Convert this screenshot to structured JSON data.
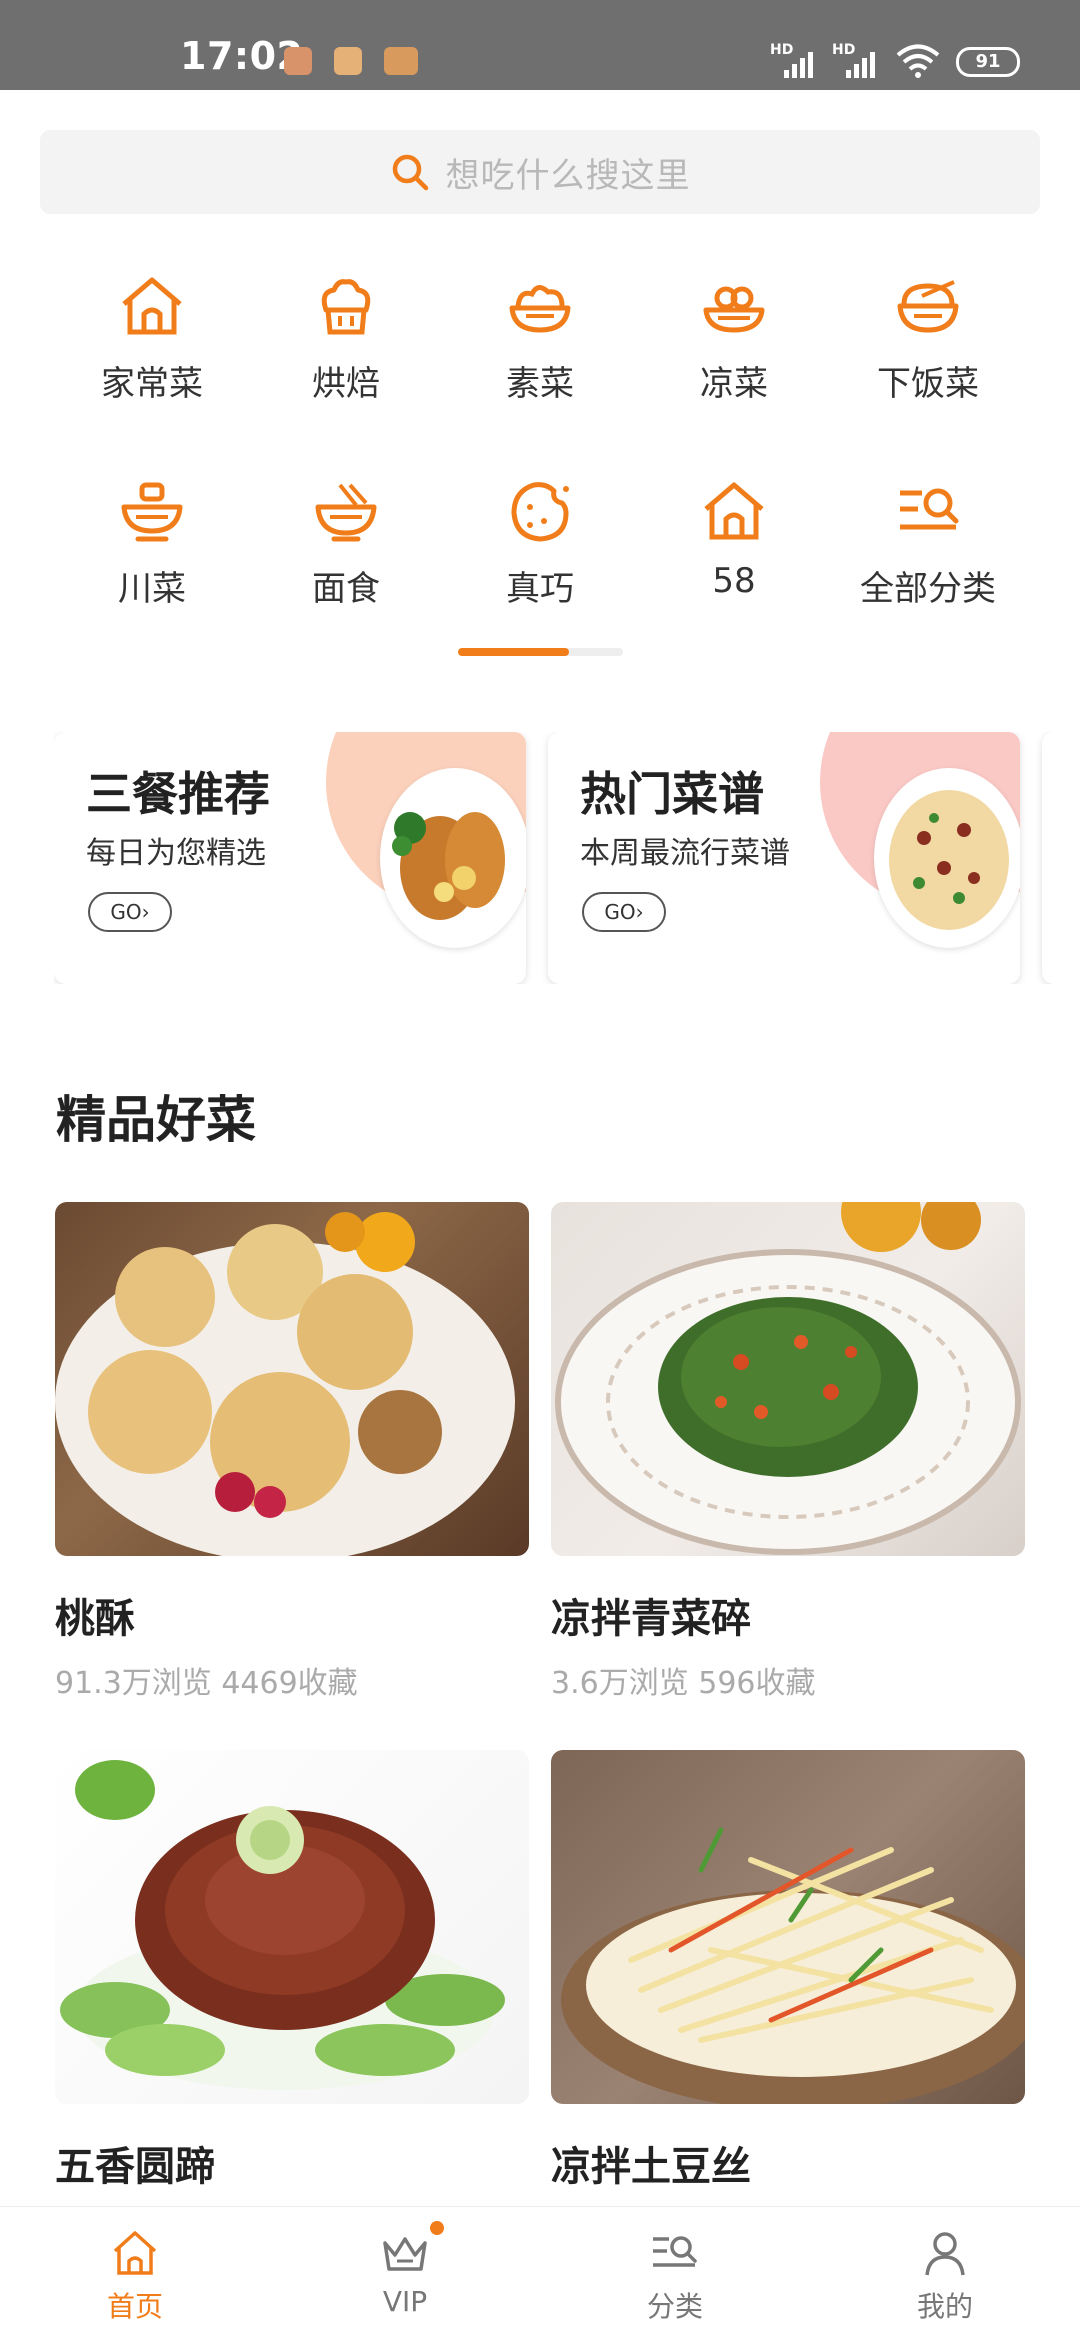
{
  "status_bar": {
    "time": "17:02",
    "network_1": "HD",
    "network_2": "HD",
    "battery": "91"
  },
  "search": {
    "placeholder": "想吃什么搜这里"
  },
  "categories": {
    "row1": [
      {
        "label": "家常菜",
        "icon": "home-cooking-icon"
      },
      {
        "label": "烘焙",
        "icon": "baking-icon"
      },
      {
        "label": "素菜",
        "icon": "vegetable-icon"
      },
      {
        "label": "凉菜",
        "icon": "cold-dish-icon"
      },
      {
        "label": "下饭菜",
        "icon": "rice-dish-icon"
      }
    ],
    "row2": [
      {
        "label": "川菜",
        "icon": "sichuan-icon"
      },
      {
        "label": "面食",
        "icon": "noodle-icon"
      },
      {
        "label": "真巧",
        "icon": "cookie-icon"
      },
      {
        "label": "58",
        "icon": "home-cooking-icon"
      },
      {
        "label": "全部分类",
        "icon": "all-categories-icon"
      }
    ],
    "page_indicator_fraction": 0.67
  },
  "features": [
    {
      "title": "三餐推荐",
      "subtitle": "每日为您精选",
      "go": "GO›"
    },
    {
      "title": "热门菜谱",
      "subtitle": "本周最流行菜谱",
      "go": "GO›"
    }
  ],
  "section": {
    "title": "精品好菜"
  },
  "recipes": [
    {
      "name": "桃酥",
      "stats": "91.3万浏览 4469收藏"
    },
    {
      "name": "凉拌青菜碎",
      "stats": "3.6万浏览 596收藏"
    },
    {
      "name": "五香圆蹄",
      "stats": ""
    },
    {
      "name": "凉拌土豆丝",
      "stats": ""
    }
  ],
  "bottom_nav": [
    {
      "label": "首页",
      "icon": "home-icon",
      "active": true
    },
    {
      "label": "VIP",
      "icon": "crown-icon",
      "active": false
    },
    {
      "label": "分类",
      "icon": "category-icon",
      "active": false
    },
    {
      "label": "我的",
      "icon": "user-icon",
      "active": false
    }
  ],
  "colors": {
    "accent": "#f07d1a",
    "text_primary": "#222222",
    "text_secondary": "#aaaaaa"
  }
}
